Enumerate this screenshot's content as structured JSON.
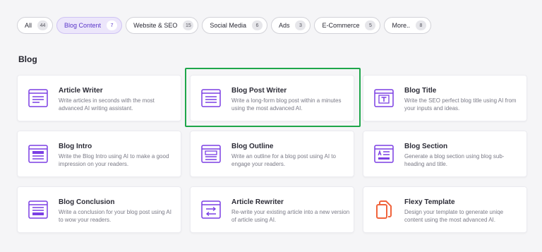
{
  "filters": [
    {
      "label": "All",
      "count": "44",
      "active": false
    },
    {
      "label": "Blog Content",
      "count": "7",
      "active": true
    },
    {
      "label": "Website & SEO",
      "count": "15",
      "active": false
    },
    {
      "label": "Social Media",
      "count": "6",
      "active": false
    },
    {
      "label": "Ads",
      "count": "3",
      "active": false
    },
    {
      "label": "E-Commerce",
      "count": "5",
      "active": false
    },
    {
      "label": "More..",
      "count": "8",
      "active": false
    }
  ],
  "section": {
    "title": "Blog"
  },
  "cards": [
    {
      "title": "Article Writer",
      "desc": "Write articles in seconds with the most advanced AI writing assistant.",
      "icon": "article-writer-icon"
    },
    {
      "title": "Blog Post Writer",
      "desc": "Write a long-form blog post within a minutes using the most advanced AI.",
      "icon": "blog-post-writer-icon"
    },
    {
      "title": "Blog Title",
      "desc": "Write the SEO perfect blog title using AI from your inputs and ideas.",
      "icon": "blog-title-icon"
    },
    {
      "title": "Blog Intro",
      "desc": "Write the Blog Intro using AI to make a good impression on your readers.",
      "icon": "blog-intro-icon"
    },
    {
      "title": "Blog Outline",
      "desc": "Write an outline for a blog post using AI to engage your readers.",
      "icon": "blog-outline-icon"
    },
    {
      "title": "Blog Section",
      "desc": "Generate a blog section using blog sub-heading and title.",
      "icon": "blog-section-icon"
    },
    {
      "title": "Blog Conclusion",
      "desc": "Write a conclusion for your blog post using AI to wow your readers.",
      "icon": "blog-conclusion-icon"
    },
    {
      "title": "Article Rewriter",
      "desc": "Re-write your existing article into a new version of article using AI.",
      "icon": "article-rewriter-icon"
    },
    {
      "title": "Flexy Template",
      "desc": "Design your template to generate uniqe content using the most advanced AI.",
      "icon": "flexy-template-icon"
    }
  ],
  "colors": {
    "accent": "#7b3fe4",
    "highlight": "#1ea64a",
    "flexy": "#f0643c"
  }
}
